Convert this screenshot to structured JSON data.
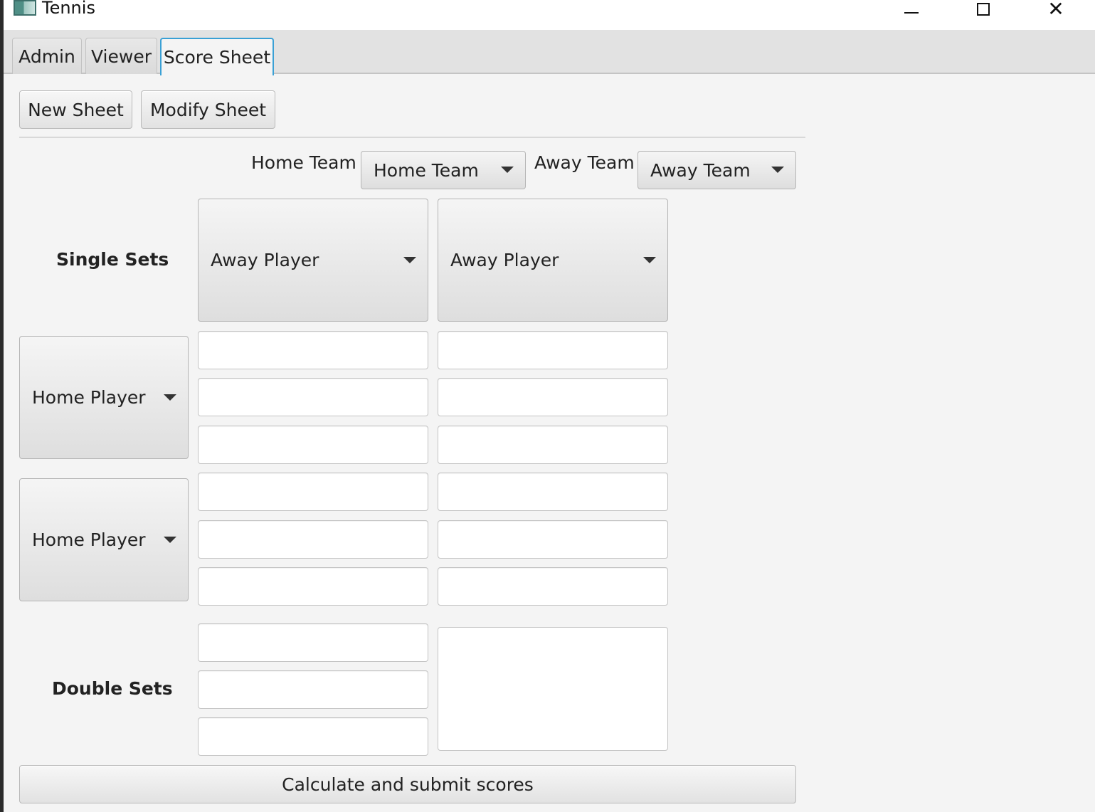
{
  "window": {
    "title": "Tennis",
    "minimize_glyph": "–",
    "maximize_glyph": "☐",
    "close_glyph": "✕"
  },
  "tabs": [
    {
      "label": "Admin",
      "active": false
    },
    {
      "label": "Viewer",
      "active": false
    },
    {
      "label": "Score Sheet",
      "active": true
    }
  ],
  "toolbar": {
    "new_sheet": "New Sheet",
    "modify_sheet": "Modify Sheet"
  },
  "teams": {
    "home_label": "Home Team",
    "home_selected": "Home Team",
    "away_label": "Away Team",
    "away_selected": "Away Team"
  },
  "single_sets": {
    "label": "Single Sets",
    "away_players": [
      "Away Player",
      "Away Player"
    ],
    "home_players": [
      "Home Player",
      "Home Player"
    ],
    "score_fields": [
      [
        "",
        ""
      ],
      [
        "",
        ""
      ],
      [
        "",
        ""
      ],
      [
        "",
        ""
      ],
      [
        "",
        ""
      ],
      [
        "",
        ""
      ]
    ]
  },
  "double_sets": {
    "label": "Double Sets",
    "score_fields": [
      "",
      "",
      ""
    ],
    "notes": ""
  },
  "submit_button": "Calculate and submit scores",
  "accent_color": "#3aa0d5"
}
